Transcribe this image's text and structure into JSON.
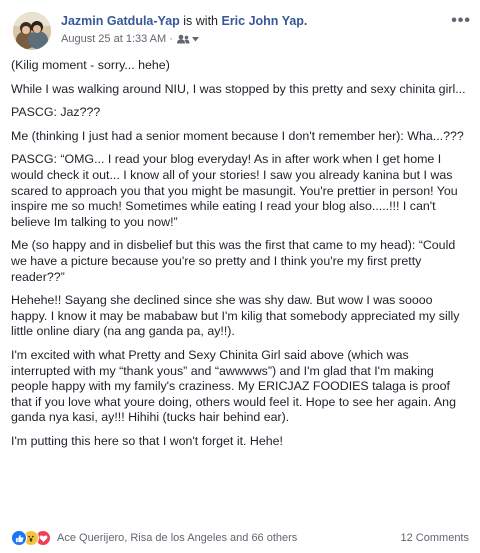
{
  "post": {
    "author": "Jazmin Gatdula-Yap",
    "with_text": "is with",
    "tagged": "Eric John Yap.",
    "timestamp": "August 25 at 1:33 AM",
    "meta_separator": "·",
    "privacy_icon": "friends-icon",
    "more_icon": "more-options-icon",
    "more_label": "•••",
    "paragraphs": [
      "(Kilig moment - sorry... hehe)",
      "While I was walking around NIU, I was stopped by this pretty and sexy chinita girl...",
      "PASCG: Jaz???",
      "Me (thinking I just had a senior moment because I don't remember her): Wha...???",
      "PASCG: “OMG... I read your blog everyday! As in after work when I get home I would check it out... I know all of your stories! I saw you already kanina but I was scared to approach you that you might be masungit. You're prettier in person! You inspire me so much! Sometimes while eating I read your blog also.....!!! I can't believe Im talking to you now!”",
      "Me (so happy and in disbelief but this was the first that came to my head): “Could we have a picture because you're so pretty and I think you're my first pretty reader??”",
      "Hehehe!! Sayang she declined since she was shy daw. But wow I was soooo happy. I know it may be mababaw but I'm kilig that somebody appreciated my silly little online diary (na ang ganda pa, ay!!).",
      "I'm excited with what Pretty and Sexy Chinita Girl said above (which was interrupted with my “thank yous” and “awwwws”) and I'm glad that I'm making people happy with my family's craziness. My ERICJAZ FOODIES talaga is proof that if you love what youre doing, others would feel it. Hope to see her again. Ang ganda nya kasi, ay!!! Hihihi (tucks hair behind ear).",
      "I'm putting this here so that I won't forget it. Hehe!"
    ],
    "reactions": [
      "like-icon",
      "wow-icon",
      "love-icon"
    ],
    "reactors_text": "Ace Querijero, Risa de los Angeles and 66 others",
    "comments_text": "12 Comments",
    "colors": {
      "link": "#365899",
      "text": "#1d2129",
      "meta": "#616770",
      "like": "#1877f2",
      "wow": "#f5c33b",
      "love": "#f33e58"
    }
  }
}
